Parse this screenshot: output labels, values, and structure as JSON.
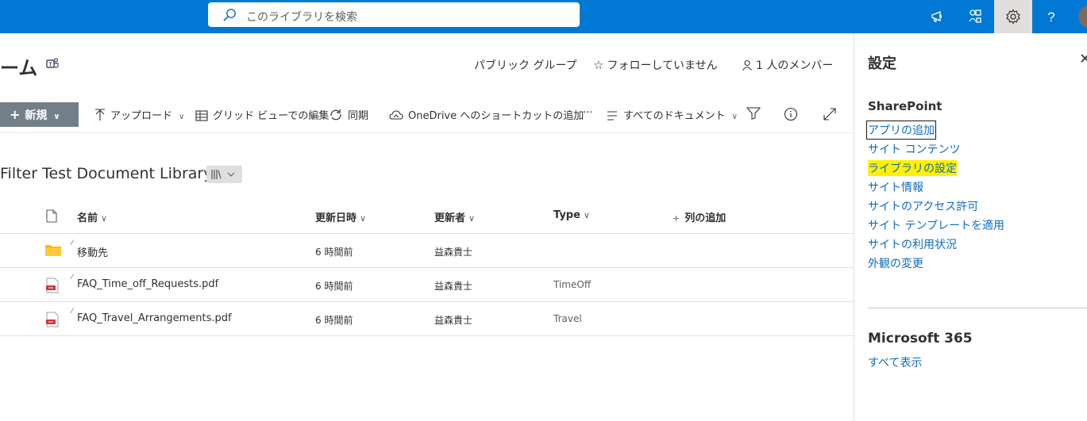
{
  "topbar": {
    "search_placeholder": "このライブラリを検索",
    "icons": [
      "megaphone-icon",
      "app-launcher-icon",
      "gear-icon",
      "help-icon"
    ]
  },
  "site": {
    "title": "ーム",
    "group_type": "パブリック グループ",
    "follow": "フォローしていません",
    "members": "1 人のメンバー"
  },
  "commandbar": {
    "new_label": "新規",
    "upload": "アップロード",
    "grid_edit": "グリッド ビューでの編集",
    "sync": "同期",
    "onedrive_shortcut": "OneDrive へのショートカットの追加",
    "more": "···",
    "view": "すべてのドキュメント"
  },
  "library": {
    "title": "Filter Test Document Library",
    "columns": {
      "name": "名前",
      "modified": "更新日時",
      "modified_by": "更新者",
      "type": "Type",
      "add_column": "列の追加"
    },
    "rows": [
      {
        "name": "移動先",
        "modified": "6 時間前",
        "modified_by": "益森貴士",
        "type": "",
        "icon": "folder-icon"
      },
      {
        "name": "FAQ_Time_off_Requests.pdf",
        "modified": "6 時間前",
        "modified_by": "益森貴士",
        "type": "TimeOff",
        "icon": "pdf-icon"
      },
      {
        "name": "FAQ_Travel_Arrangements.pdf",
        "modified": "6 時間前",
        "modified_by": "益森貴士",
        "type": "Travel",
        "icon": "pdf-icon"
      }
    ]
  },
  "settings_panel": {
    "title": "設定",
    "sharepoint_heading": "SharePoint",
    "links": [
      {
        "label": "アプリの追加"
      },
      {
        "label": "サイト コンテンツ"
      },
      {
        "label": "ライブラリの設定"
      },
      {
        "label": "サイト情報"
      },
      {
        "label": "サイトのアクセス許可"
      },
      {
        "label": "サイト テンプレートを適用"
      },
      {
        "label": "サイトの利用状況"
      },
      {
        "label": "外観の変更"
      }
    ],
    "m365_heading": "Microsoft 365",
    "show_all": "すべて表示"
  },
  "colors": {
    "suite_bar": "#0078d4",
    "link": "#0f6cbd",
    "highlight": "#fff100",
    "new_button": "#727f88",
    "folder": "#ffb900",
    "pdf": "#d13438"
  }
}
